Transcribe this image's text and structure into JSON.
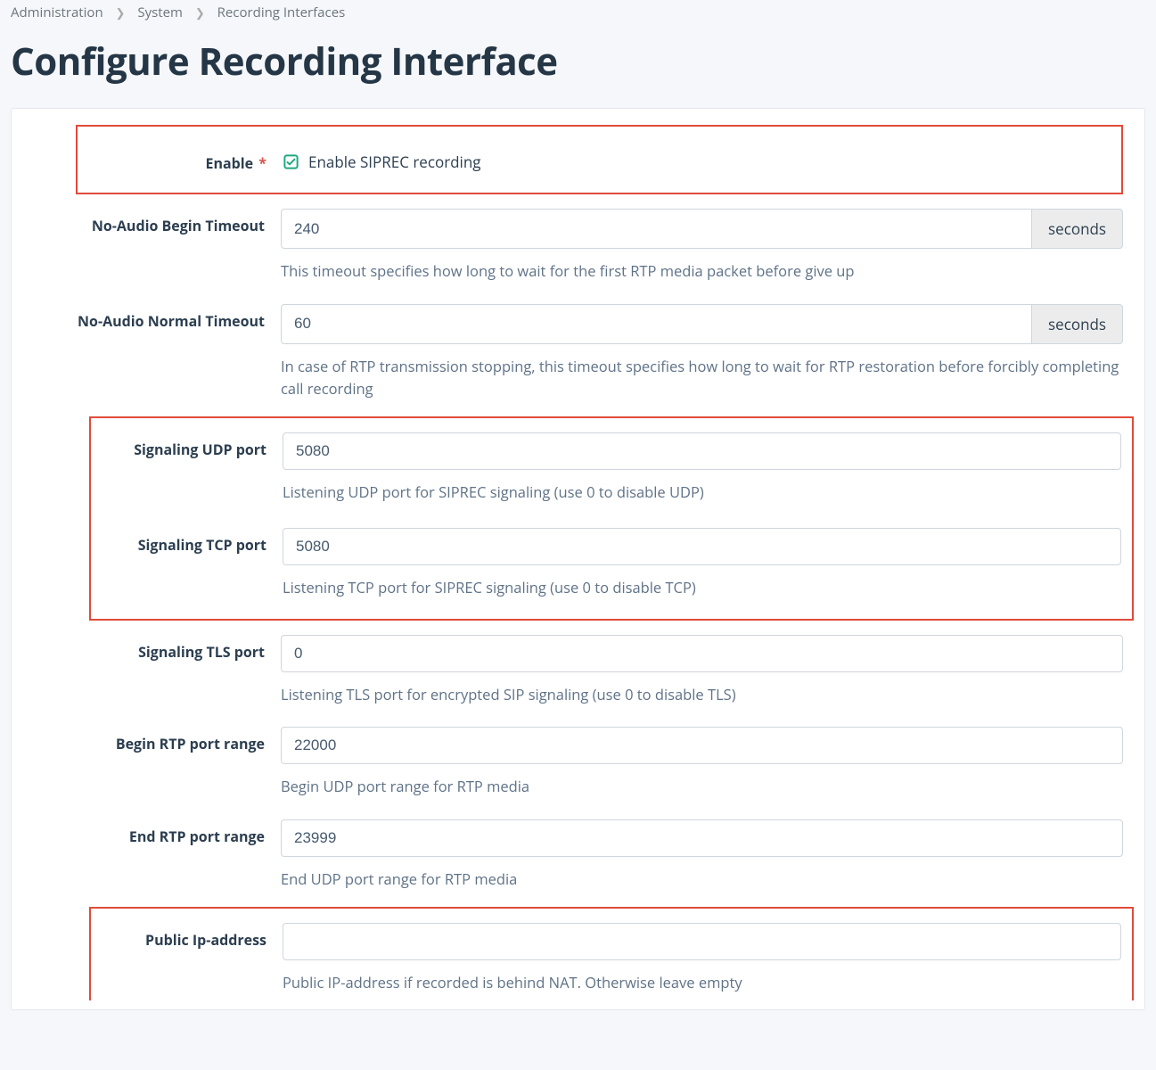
{
  "breadcrumb": {
    "administration": "Administration",
    "system": "System",
    "recording_interfaces": "Recording Interfaces"
  },
  "page_title": "Configure Recording Interface",
  "fields": {
    "enable": {
      "label": "Enable",
      "checkbox_label": "Enable SIPREC recording",
      "checked": true
    },
    "no_audio_begin": {
      "label": "No-Audio Begin Timeout",
      "value": "240",
      "unit": "seconds",
      "help": "This timeout specifies how long to wait for the first RTP media packet before give up"
    },
    "no_audio_normal": {
      "label": "No-Audio Normal Timeout",
      "value": "60",
      "unit": "seconds",
      "help": "In case of RTP transmission stopping, this timeout specifies how long to wait for RTP restoration before forcibly completing call recording"
    },
    "udp_port": {
      "label": "Signaling UDP port",
      "value": "5080",
      "help": "Listening UDP port for SIPREC signaling (use 0 to disable UDP)"
    },
    "tcp_port": {
      "label": "Signaling TCP port",
      "value": "5080",
      "help": "Listening TCP port for SIPREC signaling (use 0 to disable TCP)"
    },
    "tls_port": {
      "label": "Signaling TLS port",
      "value": "0",
      "help": "Listening TLS port for encrypted SIP signaling (use 0 to disable TLS)"
    },
    "begin_rtp": {
      "label": "Begin RTP port range",
      "value": "22000",
      "help": "Begin UDP port range for RTP media"
    },
    "end_rtp": {
      "label": "End RTP port range",
      "value": "23999",
      "help": "End UDP port range for RTP media"
    },
    "public_ip": {
      "label": "Public Ip-address",
      "value": "",
      "help": "Public IP-address if recorded is behind NAT. Otherwise leave empty"
    }
  }
}
